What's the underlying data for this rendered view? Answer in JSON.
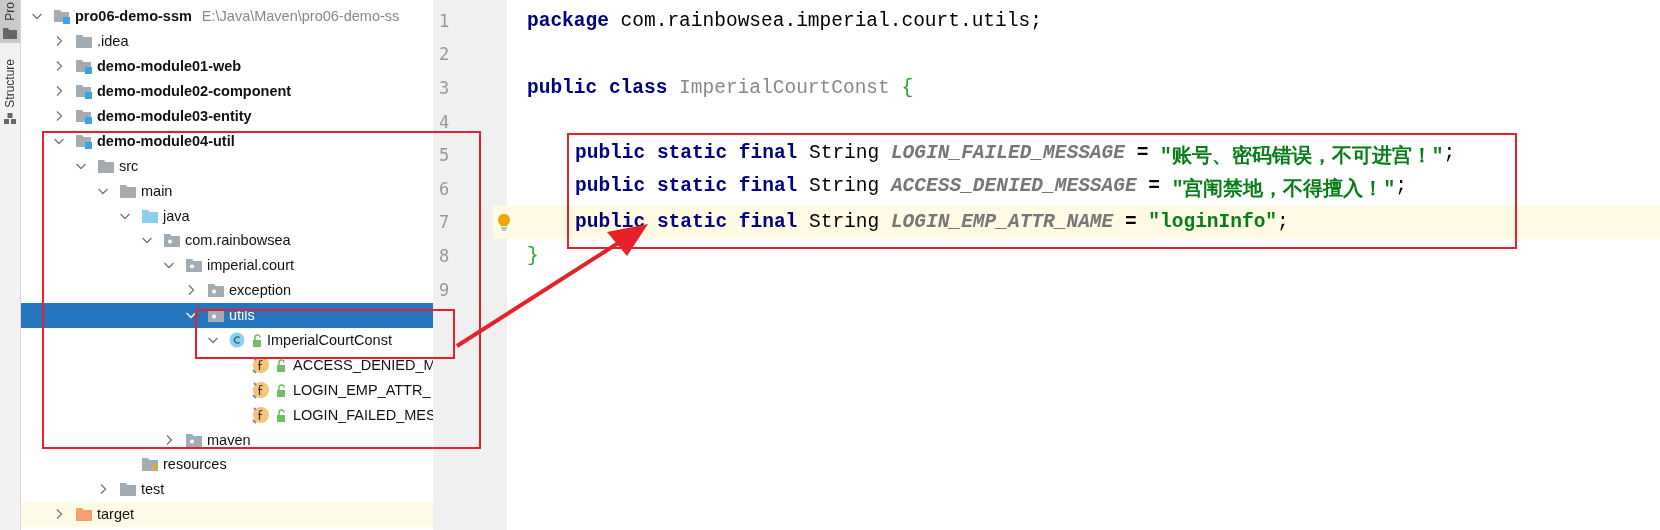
{
  "side_tabs": [
    {
      "label": "Pro",
      "selected": true
    },
    {
      "label": "Structure",
      "selected": false
    }
  ],
  "tree": [
    {
      "label": "pro06-demo-ssm",
      "path": "E:\\Java\\Maven\\pro06-demo-ss",
      "kind": "module",
      "expanded": true,
      "selected": false,
      "children": [
        {
          "label": ".idea",
          "kind": "folder",
          "expanded": false,
          "selected": false
        },
        {
          "label": "demo-module01-web",
          "kind": "module",
          "expanded": false,
          "selected": false
        },
        {
          "label": "demo-module02-component",
          "kind": "module",
          "expanded": false,
          "selected": false
        },
        {
          "label": "demo-module03-entity",
          "kind": "module",
          "expanded": false,
          "selected": false
        },
        {
          "label": "demo-module04-util",
          "kind": "module",
          "expanded": true,
          "selected": false,
          "children": [
            {
              "label": "src",
              "kind": "folder",
              "expanded": true,
              "selected": false,
              "children": [
                {
                  "label": "main",
                  "kind": "folder",
                  "expanded": true,
                  "selected": false,
                  "children": [
                    {
                      "label": "java",
                      "kind": "source",
                      "expanded": true,
                      "selected": false,
                      "children": [
                        {
                          "label": "com.rainbowsea",
                          "kind": "package",
                          "expanded": true,
                          "selected": false,
                          "children": [
                            {
                              "label": "imperial.court",
                              "kind": "package",
                              "expanded": true,
                              "selected": false,
                              "children": [
                                {
                                  "label": "exception",
                                  "kind": "package",
                                  "expanded": false,
                                  "selected": false
                                },
                                {
                                  "label": "utils",
                                  "kind": "package",
                                  "expanded": true,
                                  "selected": true,
                                  "children": [
                                    {
                                      "label": "ImperialCourtConst",
                                      "kind": "class",
                                      "expanded": true,
                                      "selected": false,
                                      "children": [
                                        {
                                          "label": "ACCESS_DENIED_M",
                                          "kind": "field",
                                          "selected": false
                                        },
                                        {
                                          "label": "LOGIN_EMP_ATTR_",
                                          "kind": "field",
                                          "selected": false
                                        },
                                        {
                                          "label": "LOGIN_FAILED_MES",
                                          "kind": "field",
                                          "selected": false
                                        }
                                      ]
                                    }
                                  ]
                                }
                              ]
                            },
                            {
                              "label": "maven",
                              "kind": "package",
                              "expanded": false,
                              "selected": false
                            }
                          ]
                        }
                      ]
                    },
                    {
                      "label": "resources",
                      "kind": "resources",
                      "selected": false
                    }
                  ]
                },
                {
                  "label": "test",
                  "kind": "folder",
                  "expanded": false,
                  "selected": false
                }
              ]
            }
          ]
        },
        {
          "label": "target",
          "kind": "excluded",
          "expanded": false,
          "selected": false
        }
      ]
    }
  ],
  "editor": {
    "lines": [
      {
        "number": "1",
        "kind": "top",
        "current": false,
        "tokens": [
          {
            "text": "package",
            "kind": "keyword"
          },
          {
            "text": "com.rainbowsea.imperial.court.utils;",
            "kind": "plain"
          }
        ]
      },
      {
        "number": "2",
        "kind": "top",
        "current": false
      },
      {
        "number": "3",
        "kind": "top",
        "current": false,
        "tokens": [
          {
            "text": "public",
            "kind": "keyword"
          },
          {
            "text": "class",
            "kind": "keyword"
          },
          {
            "text": "ImperialCourtConst",
            "kind": "class"
          },
          {
            "text": "{",
            "kind": "brace"
          }
        ]
      },
      {
        "number": "4",
        "kind": "top",
        "current": false
      },
      {
        "number": "5",
        "kind": "member",
        "current": false,
        "tokens": [
          {
            "text": "public",
            "kind": "keyword"
          },
          {
            "text": "static",
            "kind": "keyword"
          },
          {
            "text": "final",
            "kind": "keyword"
          },
          {
            "text": "String",
            "kind": "plain"
          },
          {
            "text": "LOGIN_FAILED_MESSAGE",
            "kind": "constant"
          },
          {
            "text": "=",
            "kind": "operator"
          },
          {
            "text": "\"账号、密码错误，不可进宫！\"",
            "kind": "string"
          },
          {
            "text": ";",
            "kind": "punct"
          }
        ]
      },
      {
        "number": "6",
        "kind": "member",
        "current": false,
        "tokens": [
          {
            "text": "public",
            "kind": "keyword"
          },
          {
            "text": "static",
            "kind": "keyword"
          },
          {
            "text": "final",
            "kind": "keyword"
          },
          {
            "text": "String",
            "kind": "plain"
          },
          {
            "text": "ACCESS_DENIED_MESSAGE",
            "kind": "constant"
          },
          {
            "text": "=",
            "kind": "operator"
          },
          {
            "text": "\"宫闱禁地，不得擅入！\"",
            "kind": "string"
          },
          {
            "text": ";",
            "kind": "punct"
          }
        ]
      },
      {
        "number": "7",
        "kind": "member",
        "current": true,
        "tokens": [
          {
            "text": "public",
            "kind": "keyword"
          },
          {
            "text": "static",
            "kind": "keyword"
          },
          {
            "text": "final",
            "kind": "keyword"
          },
          {
            "text": "String",
            "kind": "plain"
          },
          {
            "text": "LOGIN_EMP_ATTR_NAME",
            "kind": "constant"
          },
          {
            "text": "=",
            "kind": "operator"
          },
          {
            "text": "\"loginInfo\"",
            "kind": "string"
          },
          {
            "text": ";",
            "kind": "punct"
          }
        ]
      },
      {
        "number": "8",
        "kind": "top",
        "current": false,
        "tokens": [
          {
            "text": "}",
            "kind": "brace"
          }
        ]
      },
      {
        "number": "9",
        "kind": "top",
        "current": false
      }
    ]
  }
}
